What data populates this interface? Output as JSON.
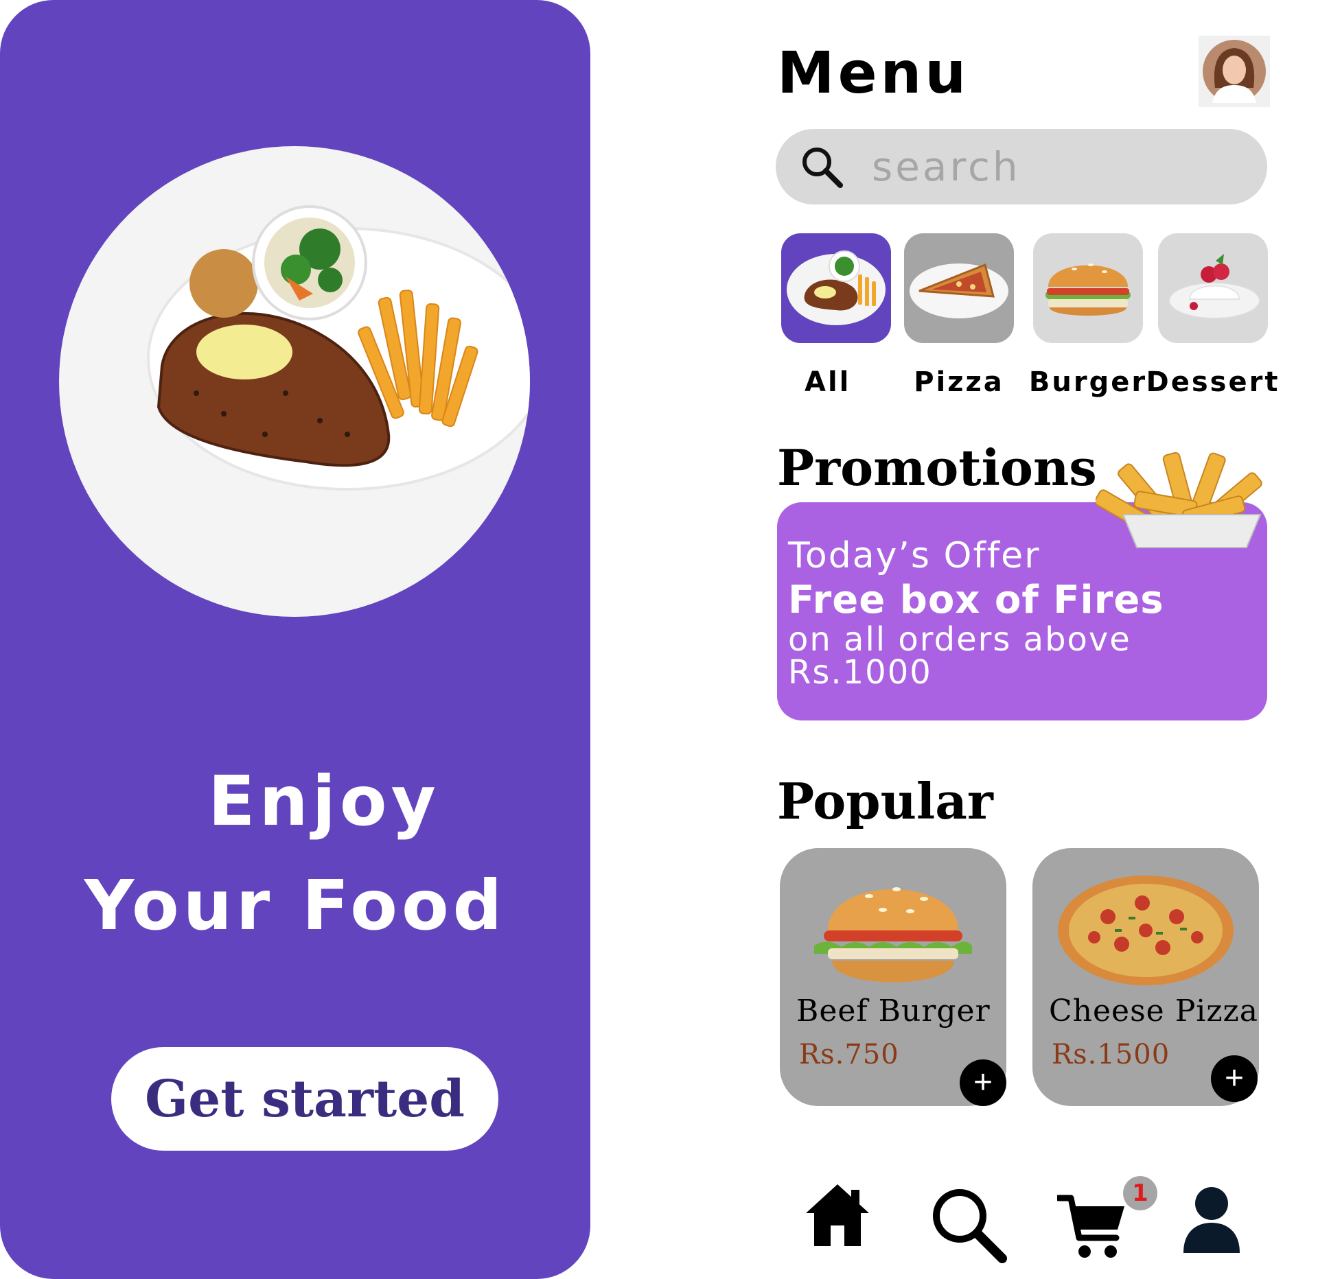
{
  "splash": {
    "headline_line1": "Enjoy",
    "headline_line2": "Your Food",
    "cta_label": "Get started",
    "background_color": "#6244be"
  },
  "menu": {
    "title": "Menu",
    "avatar_icon": "user-avatar-photo",
    "search": {
      "placeholder": "search",
      "value": "",
      "icon": "search-icon"
    },
    "categories": [
      {
        "label": "All",
        "icon": "steak-plate-icon",
        "active": true
      },
      {
        "label": "Pizza",
        "icon": "pizza-slice-icon",
        "active": false
      },
      {
        "label": "Burger",
        "icon": "burger-icon",
        "active": false
      },
      {
        "label": "Dessert",
        "icon": "dessert-icon",
        "active": false
      }
    ],
    "promotions": {
      "title": "Promotions",
      "offer_label": "Today’s Offer",
      "offer_headline": "Free box of Fires",
      "offer_detail": "on all orders above Rs.1000",
      "card_color": "#aa62e3"
    },
    "popular": {
      "title": "Popular",
      "items": [
        {
          "name": "Beef Burger",
          "price": "Rs.750",
          "add_label": "+"
        },
        {
          "name": "Cheese Pizza",
          "price": "Rs.1500",
          "add_label": "+"
        }
      ]
    },
    "bottom_nav": {
      "items": [
        "home-icon",
        "search-icon",
        "cart-icon",
        "profile-icon"
      ],
      "cart_badge": "1",
      "badge_color": "#e01b1b"
    }
  }
}
